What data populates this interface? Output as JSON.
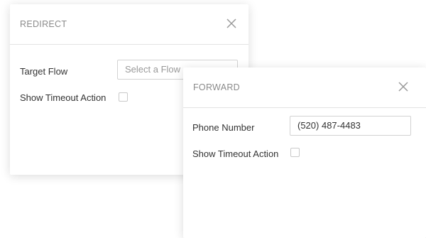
{
  "redirect": {
    "title": "REDIRECT",
    "close_icon": "close-icon",
    "target_flow": {
      "label": "Target Flow",
      "placeholder": "Select a Flow",
      "value": ""
    },
    "show_timeout_action": {
      "label": "Show Timeout Action",
      "checked": false
    }
  },
  "forward": {
    "title": "FORWARD",
    "close_icon": "close-icon",
    "phone_number": {
      "label": "Phone Number",
      "value": "(520) 487-4483"
    },
    "show_timeout_action": {
      "label": "Show Timeout Action",
      "checked": false
    }
  },
  "colors": {
    "title_text": "#8a8a8a",
    "border": "#d2d2d2",
    "divider": "#e3e3e3",
    "icon": "#9a9a9a"
  }
}
